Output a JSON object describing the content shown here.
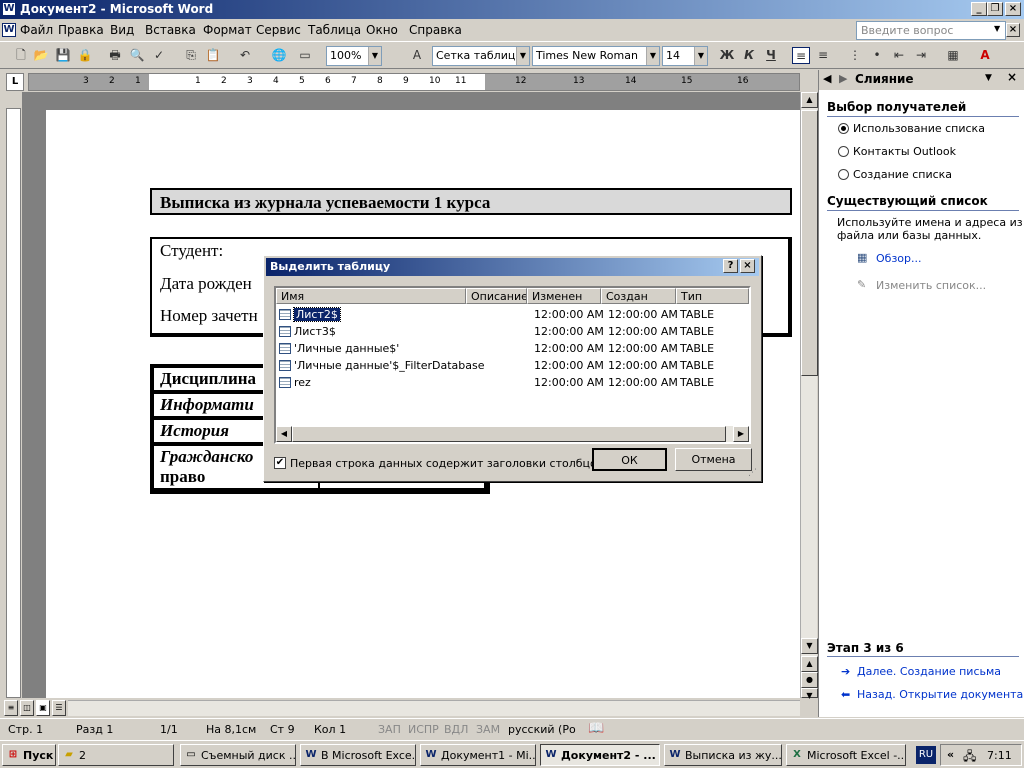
{
  "window": {
    "title": "Документ2 - Microsoft Word"
  },
  "menu": {
    "items": [
      "Файл",
      "Правка",
      "Вид",
      "Вставка",
      "Формат",
      "Сервис",
      "Таблица",
      "Окно",
      "Справка"
    ],
    "help_placeholder": "Введите вопрос"
  },
  "toolbar": {
    "zoom": "100%",
    "style": "Сетка таблицы",
    "font": "Times New Roman",
    "size": "14",
    "bold": "Ж",
    "italic": "К",
    "underline": "Ч"
  },
  "ruler": {
    "marks": [
      "3",
      "2",
      "1",
      "1",
      "2",
      "3",
      "4",
      "5",
      "6",
      "7",
      "8",
      "9",
      "10",
      "11",
      "12",
      "13",
      "14",
      "15",
      "16"
    ]
  },
  "document": {
    "title": "Выписка из журнала успеваемости 1 курса",
    "lines": [
      "Студент:",
      "Дата рожден",
      "Номер зачетн"
    ],
    "rows": [
      "Дисциплина",
      "Информати",
      "История",
      "Гражданско",
      "право"
    ]
  },
  "dialog": {
    "title": "Выделить таблицу",
    "columns": [
      "Имя",
      "Описание",
      "Изменен",
      "Создан",
      "Тип"
    ],
    "rows": [
      {
        "name": "Лист2$",
        "modified": "12:00:00 AM",
        "created": "12:00:00 AM",
        "type": "TABLE",
        "selected": true
      },
      {
        "name": "Лист3$",
        "modified": "12:00:00 AM",
        "created": "12:00:00 AM",
        "type": "TABLE"
      },
      {
        "name": "'Личные данные$'",
        "modified": "12:00:00 AM",
        "created": "12:00:00 AM",
        "type": "TABLE"
      },
      {
        "name": "'Личные данные'$_FilterDatabase",
        "modified": "12:00:00 AM",
        "created": "12:00:00 AM",
        "type": "TABLE"
      },
      {
        "name": "rez",
        "modified": "12:00:00 AM",
        "created": "12:00:00 AM",
        "type": "TABLE"
      }
    ],
    "checkbox_label": "Первая строка данных содержит заголовки столбцов",
    "checkbox_checked": true,
    "ok": "ОК",
    "cancel": "Отмена"
  },
  "taskpane": {
    "title": "Слияние",
    "section1": "Выбор получателей",
    "options": [
      "Использование списка",
      "Контакты Outlook",
      "Создание списка"
    ],
    "selected_option": 0,
    "section2": "Существующий список",
    "description": [
      "Используйте имена и адреса из",
      "файла или базы данных."
    ],
    "browse": "Обзор...",
    "edit_list": "Изменить список...",
    "step": "Этап 3 из 6",
    "next": "Далее. Создание письма",
    "back": "Назад. Открытие документа"
  },
  "status": {
    "page": "Стр. 1",
    "section": "Разд 1",
    "pages": "1/1",
    "at": "На 8,1см",
    "line": "Ст 9",
    "col": "Кол 1",
    "rec": "ЗАП",
    "trk": "ИСПР",
    "ext": "ВДЛ",
    "ovr": "ЗАМ",
    "lang": "русский (Ро"
  },
  "taskbar": {
    "start": "Пуск",
    "items": [
      "2",
      "Съемный диск ...",
      "В Microsoft Exce...",
      "Документ1 - Mi...",
      "Документ2 - ...",
      "Выписка из жу...",
      "Microsoft Excel -..."
    ],
    "lang": "RU",
    "clock": "7:11"
  },
  "colors": {
    "title_start": "#0a246a",
    "title_end": "#a6caf0",
    "link": "#0033cc",
    "face": "#d4d0c8"
  }
}
